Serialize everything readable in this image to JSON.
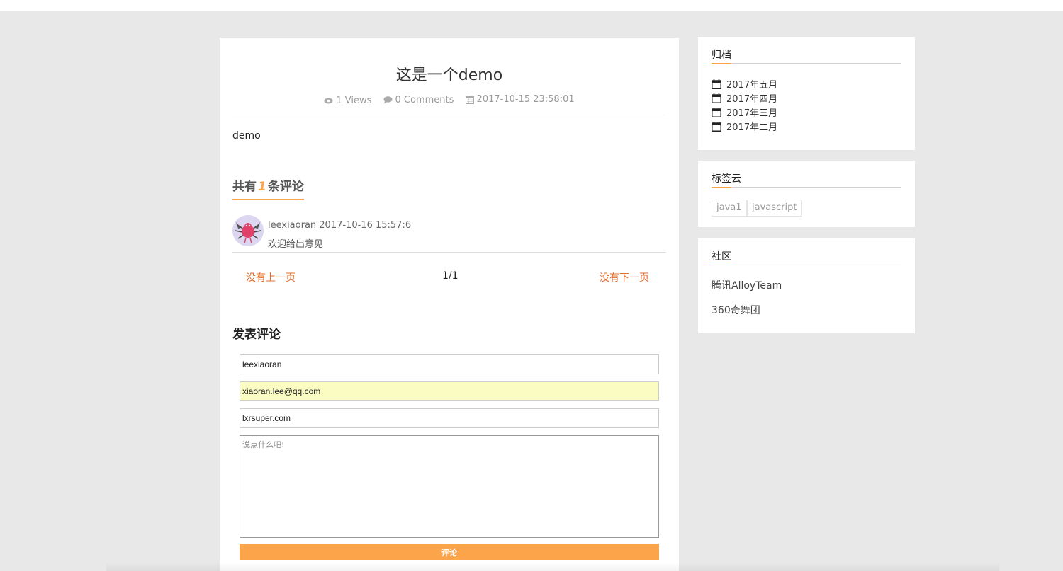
{
  "post": {
    "title": "这是一个demo",
    "views": "1 Views",
    "comments": "0 Comments",
    "date": "2017-10-15 23:58:01",
    "body": "demo"
  },
  "comments_section": {
    "heading_prefix": "共有",
    "count": "1",
    "heading_suffix": "条评论",
    "items": [
      {
        "meta": "leexiaoran 2017-10-16 15:57:6",
        "text": "欢迎给出意见"
      }
    ]
  },
  "pager": {
    "prev": "没有上一页",
    "page": "1/1",
    "next": "没有下一页"
  },
  "form": {
    "heading": "发表评论",
    "name_value": "leexiaoran",
    "email_value": "xiaoran.lee@qq.com",
    "site_value": "lxrsuper.com",
    "comment_placeholder": "说点什么吧!",
    "submit_label": "评论"
  },
  "sidebar": {
    "archive": {
      "title": "归档",
      "items": [
        "2017年五月",
        "2017年四月",
        "2017年三月",
        "2017年二月"
      ]
    },
    "tags": {
      "title": "标签云",
      "items": [
        "java1",
        "javascript"
      ]
    },
    "community": {
      "title": "社区",
      "links": [
        "腾讯AlloyTeam",
        "360奇舞团"
      ]
    }
  },
  "colors": {
    "accent": "#fca44a",
    "link": "#e66e2c",
    "autofill": "#fafcc2"
  }
}
